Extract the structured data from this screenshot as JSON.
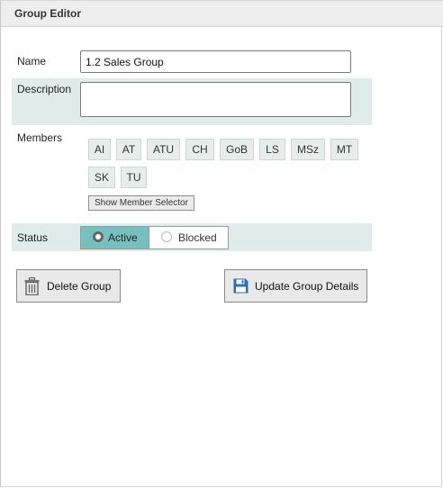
{
  "window": {
    "title": "Group Editor"
  },
  "form": {
    "name_label": "Name",
    "name_value": "1.2 Sales Group",
    "description_label": "Description",
    "description_value": "",
    "members_label": "Members",
    "members": [
      "AI",
      "AT",
      "ATU",
      "CH",
      "GoB",
      "LS",
      "MSz",
      "MT",
      "SK",
      "TU"
    ],
    "show_member_selector_label": "Show Member Selector",
    "status_label": "Status",
    "status_options": [
      "Active",
      "Blocked"
    ],
    "status_selected": "Active"
  },
  "actions": {
    "delete_label": "Delete Group",
    "update_label": "Update Group Details"
  },
  "icons": {
    "delete": "trash-icon",
    "update": "save-icon"
  },
  "colors": {
    "shaded_row": "#e0ecea",
    "active_status": "#78c0bf",
    "save_icon": "#2a6fb0"
  }
}
